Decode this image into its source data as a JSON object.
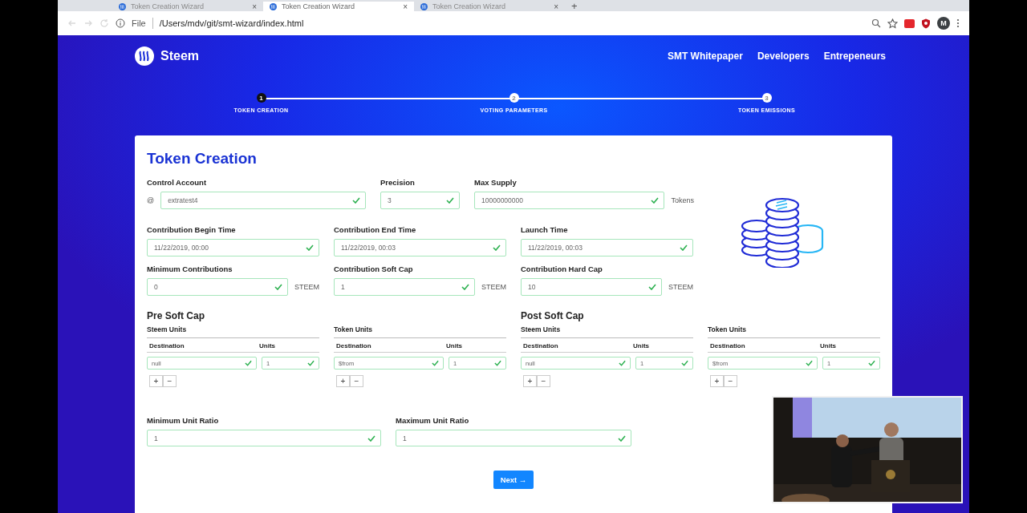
{
  "browser": {
    "tabs": [
      {
        "title": "Token Creation Wizard",
        "selected": false
      },
      {
        "title": "Token Creation Wizard",
        "selected": true
      },
      {
        "title": "Token Creation Wizard",
        "selected": false
      }
    ],
    "new_tab": "+",
    "close": "×",
    "scheme": "File",
    "url": "/Users/mdv/git/smt-wizard/index.html",
    "profile": "M"
  },
  "header": {
    "brand": "Steem",
    "nav": [
      "SMT Whitepaper",
      "Developers",
      "Entrepeneurs"
    ]
  },
  "steps": [
    {
      "number": "1",
      "label": "TOKEN CREATION",
      "selected": true
    },
    {
      "number": "2",
      "label": "VOTING PARAMETERS",
      "selected": false
    },
    {
      "number": "3",
      "label": "TOKEN EMISSIONS",
      "selected": false
    }
  ],
  "form": {
    "title": "Token Creation",
    "rows": [
      {
        "fields": [
          {
            "label": "Control Account",
            "prefix": "@",
            "value": "extratest4",
            "valid": true
          },
          {
            "label": "Precision",
            "value": "3",
            "valid": true
          },
          {
            "label": "Max Supply",
            "value": "10000000000",
            "suffix": "Tokens",
            "valid": true
          }
        ]
      },
      {
        "fields": [
          {
            "label": "Contribution Begin Time",
            "value": "11/22/2019, 00:00",
            "valid": true
          },
          {
            "label": "Contribution End Time",
            "value": "11/22/2019, 00:03",
            "valid": true
          },
          {
            "label": "Launch Time",
            "value": "11/22/2019, 00:03",
            "valid": true
          }
        ]
      },
      {
        "fields": [
          {
            "label": "Minimum Contributions",
            "value": "0",
            "suffix": "STEEM",
            "valid": true
          },
          {
            "label": "Contribution Soft Cap",
            "value": "1",
            "suffix": "STEEM",
            "valid": true
          },
          {
            "label": "Contribution Hard Cap",
            "value": "10",
            "suffix": "STEEM",
            "valid": true
          }
        ]
      }
    ],
    "sections": [
      {
        "title": "Pre Soft Cap",
        "tables": [
          {
            "title": "Steem Units",
            "columns": [
              "Destination",
              "Units"
            ],
            "entries": [
              {
                "destination": {
                  "value": "null",
                  "valid": true
                },
                "units": {
                  "value": "1",
                  "valid": true
                }
              }
            ],
            "add": "+",
            "remove": "−"
          },
          {
            "title": "Token Units",
            "columns": [
              "Destination",
              "Units"
            ],
            "entries": [
              {
                "destination": {
                  "value": "$from",
                  "valid": true
                },
                "units": {
                  "value": "1",
                  "valid": true
                }
              }
            ],
            "add": "+",
            "remove": "−"
          }
        ]
      },
      {
        "title": "Post Soft Cap",
        "tables": [
          {
            "title": "Steem Units",
            "columns": [
              "Destination",
              "Units"
            ],
            "entries": [
              {
                "destination": {
                  "value": "null",
                  "valid": true
                },
                "units": {
                  "value": "1",
                  "valid": true
                }
              }
            ],
            "add": "+",
            "remove": "−"
          },
          {
            "title": "Token Units",
            "columns": [
              "Destination",
              "Units"
            ],
            "entries": [
              {
                "destination": {
                  "value": "$from",
                  "valid": true
                },
                "units": {
                  "value": "1",
                  "valid": true
                }
              }
            ],
            "add": "+",
            "remove": "−"
          }
        ]
      }
    ],
    "ratios": [
      {
        "label": "Minimum Unit Ratio",
        "value": "1",
        "valid": true
      },
      {
        "label": "Maximum Unit Ratio",
        "value": "1",
        "valid": true
      }
    ],
    "next": "Next →"
  }
}
